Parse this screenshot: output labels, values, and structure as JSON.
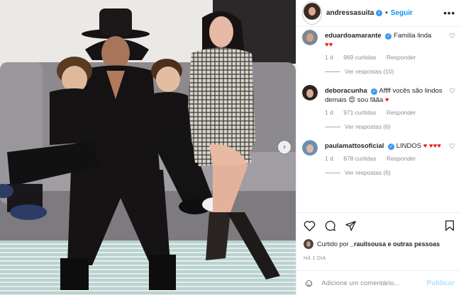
{
  "post": {
    "username": "andressasuita",
    "follow_label": "Seguir",
    "more_label": "•••",
    "dot": "•"
  },
  "comments": [
    {
      "user": "eduardoamarante",
      "text": "Familia linda",
      "trail": "♥♥",
      "time": "1 d",
      "likes": "969 curtidas",
      "reply": "Responder",
      "view_replies": "Ver respostas (10)"
    },
    {
      "user": "deboracunha",
      "text": "Affff vocês são lindos demais 😍 sou fããa",
      "trail": "♥",
      "time": "1 d",
      "likes": "971 curtidas",
      "reply": "Responder",
      "view_replies": "Ver respostas (6)"
    },
    {
      "user": "paulamattosoficial",
      "text": "LINDOS",
      "trail": "♥ ♥♥♥",
      "time": "1 d",
      "likes": "878 curtidas",
      "reply": "Responder",
      "view_replies": "Ver respostas (6)"
    }
  ],
  "liked_by": {
    "prefix": "Curtido por",
    "user": "_raullsousa",
    "suffix": "e outras pessoas"
  },
  "date": "HÁ 1 DIA",
  "comment_box": {
    "placeholder": "Adicione um comentário...",
    "post_label": "Publicar"
  },
  "colors": {
    "accent": "#0095f6",
    "verified": "#3897f0",
    "heart": "#ed1c24"
  },
  "icons": [
    "verified-icon",
    "heart-icon",
    "comment-icon",
    "share-icon",
    "bookmark-icon",
    "emoji-icon",
    "chevron-right-icon",
    "more-icon"
  ]
}
